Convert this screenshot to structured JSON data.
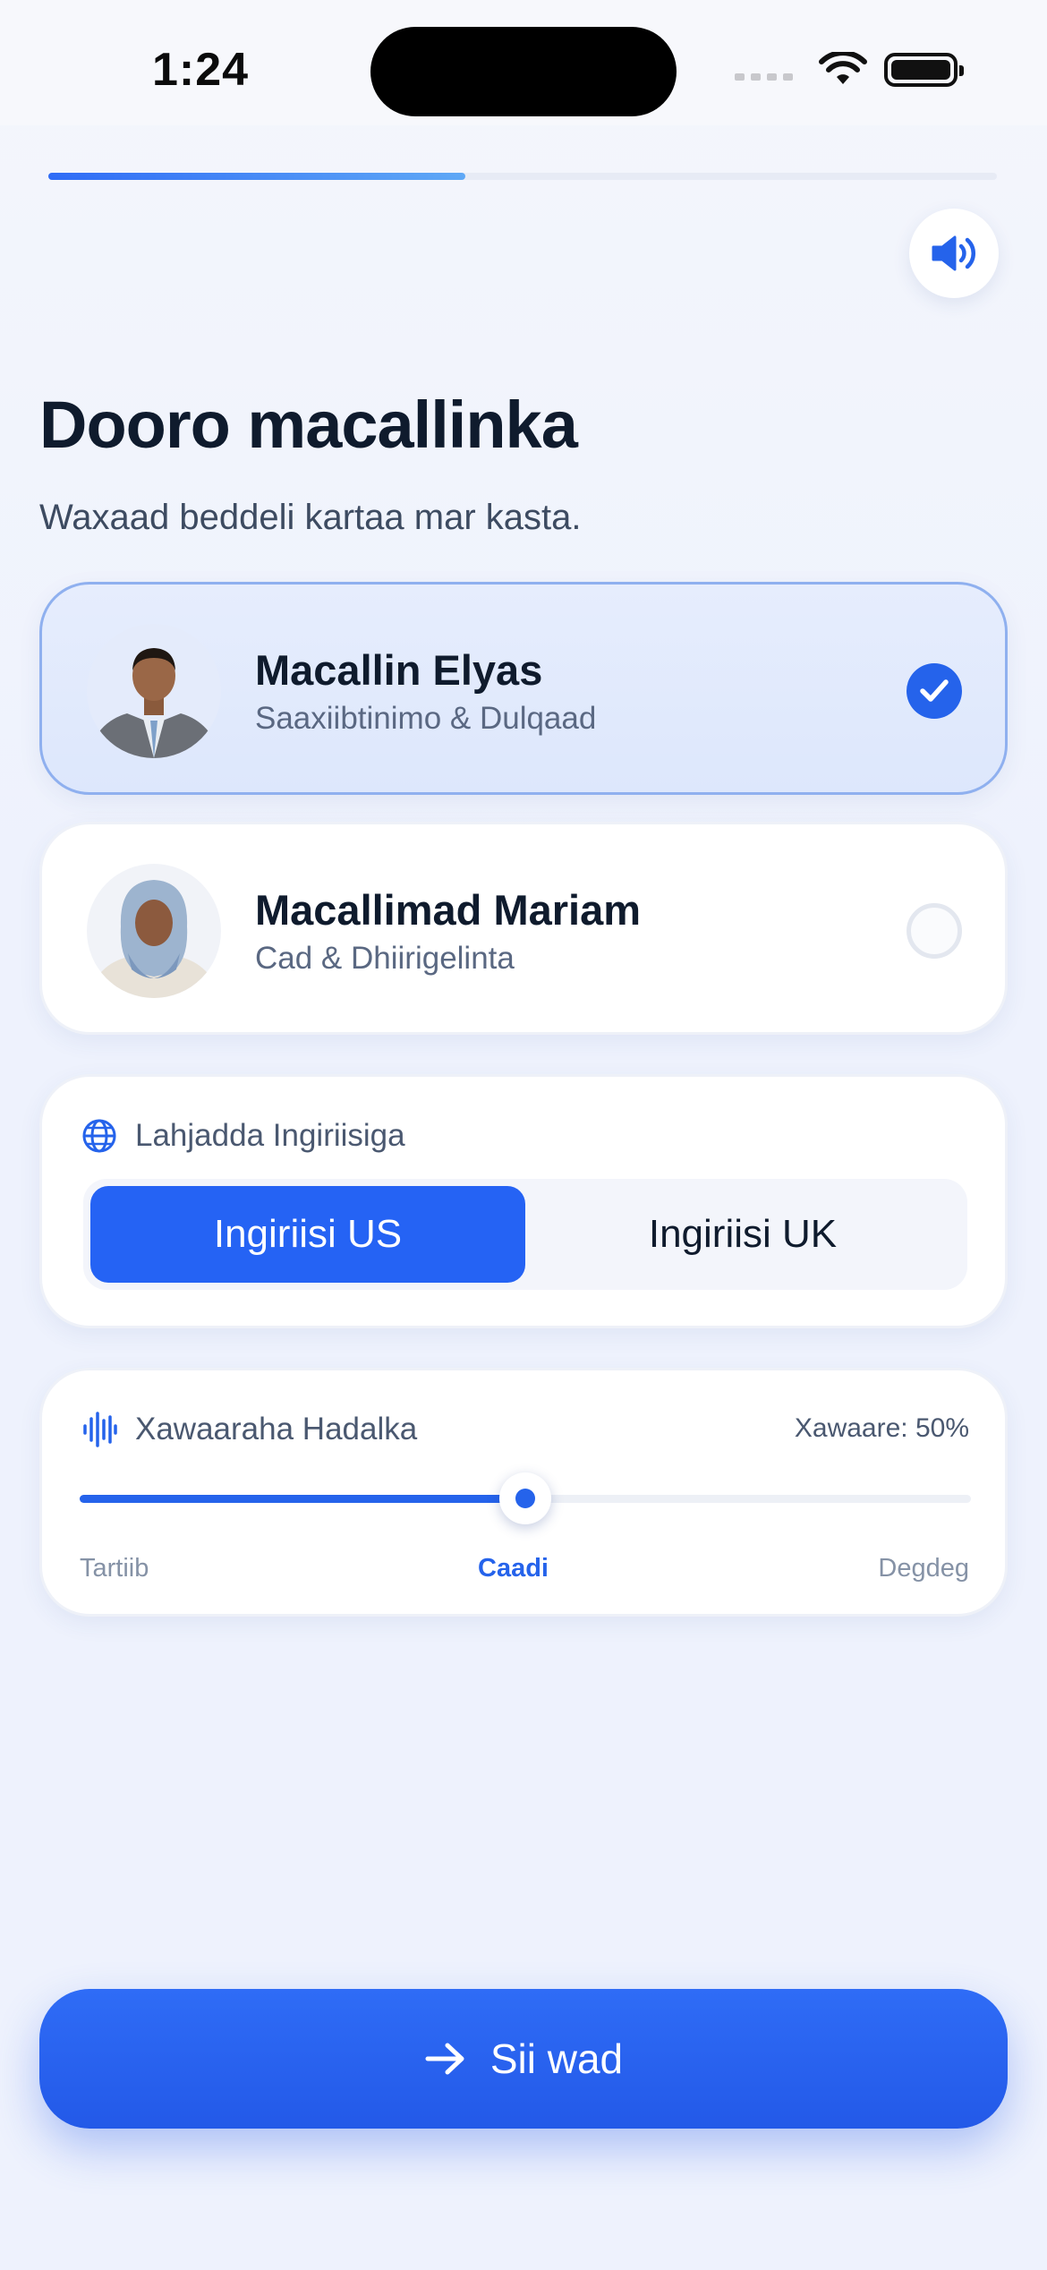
{
  "status_bar": {
    "time": "1:24"
  },
  "progress": {
    "fraction": 0.44
  },
  "header": {
    "title": "Dooro macallinka",
    "subtitle": "Waxaad beddeli kartaa mar kasta."
  },
  "teachers": [
    {
      "name": "Macallin Elyas",
      "role": "Saaxiibtinimo & Dulqaad",
      "selected": true,
      "avatar": "male-teacher-avatar"
    },
    {
      "name": "Macallimad Mariam",
      "role": "Cad & Dhiirigelinta",
      "selected": false,
      "avatar": "female-teacher-avatar"
    }
  ],
  "accent": {
    "label": "Lahjadda Ingiriisiga",
    "icon": "globe-icon",
    "options": [
      "Ingiriisi US",
      "Ingiriisi UK"
    ],
    "selected": "Ingiriisi US"
  },
  "speed": {
    "label": "Xawaaraha Hadalka",
    "icon": "waveform-icon",
    "value_label": "Xawaare: 50%",
    "value": 0.5,
    "ticks": [
      "Tartiib",
      "Caadi",
      "Degdeg"
    ]
  },
  "continue_button": {
    "label": "Sii wad",
    "icon": "arrow-right-icon"
  },
  "colors": {
    "accent": "#2563EB",
    "title": "#0F1B2D",
    "card_selected": "#DDE7FC"
  }
}
